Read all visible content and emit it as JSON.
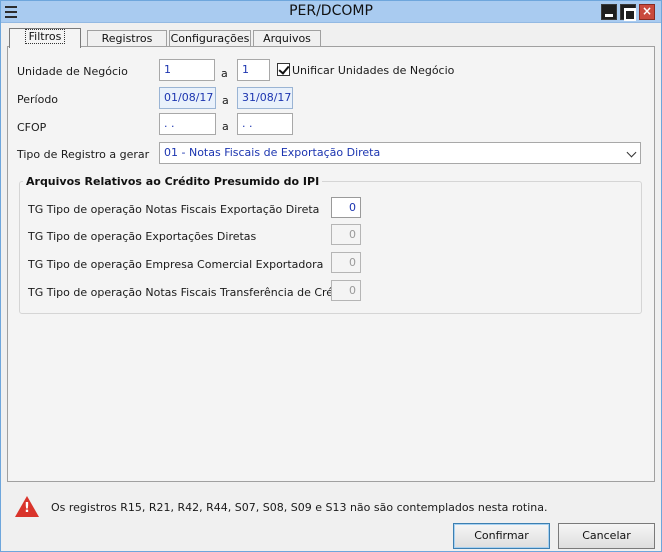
{
  "window": {
    "title": "PER/DCOMP"
  },
  "tabs": [
    {
      "label": "Filtros"
    },
    {
      "label": "Registros"
    },
    {
      "label": "Configurações"
    },
    {
      "label": "Arquivos"
    }
  ],
  "filters": {
    "unidade_label": "Unidade de Negócio",
    "unidade_from": "1",
    "unidade_to": "1",
    "separator": "a",
    "unificar_label": "Unificar Unidades de Negócio",
    "unificar_checked": true,
    "periodo_label": "Período",
    "periodo_from": "01/08/17",
    "periodo_to": "31/08/17",
    "cfop_label": "CFOP",
    "cfop_from": " . .",
    "cfop_to": " . .",
    "tipo_label": "Tipo de Registro a gerar",
    "tipo_value": "01 - Notas Fiscais de Exportação Direta"
  },
  "credit_group": {
    "title": "Arquivos Relativos ao Crédito Presumido do IPI",
    "rows": [
      {
        "label": "TG Tipo de operação Notas Fiscais Exportação Direta",
        "value": "0",
        "enabled": true
      },
      {
        "label": "TG Tipo de operação Exportações Diretas",
        "value": "0",
        "enabled": false
      },
      {
        "label": "TG Tipo de operação Empresa Comercial Exportadora",
        "value": "0",
        "enabled": false
      },
      {
        "label": "TG Tipo de operação Notas Fiscais Transferência de Crédito",
        "value": "0",
        "enabled": false
      }
    ]
  },
  "footer": {
    "warning_text": "Os registros R15, R21, R42, R44, S07, S08, S09 e S13 não são contemplados nesta rotina.",
    "confirm_label": "Confirmar",
    "cancel_label": "Cancelar"
  },
  "colors": {
    "titlebar": "#a9cbf0",
    "value_text": "#1c35b0",
    "warning": "#d9342b"
  }
}
